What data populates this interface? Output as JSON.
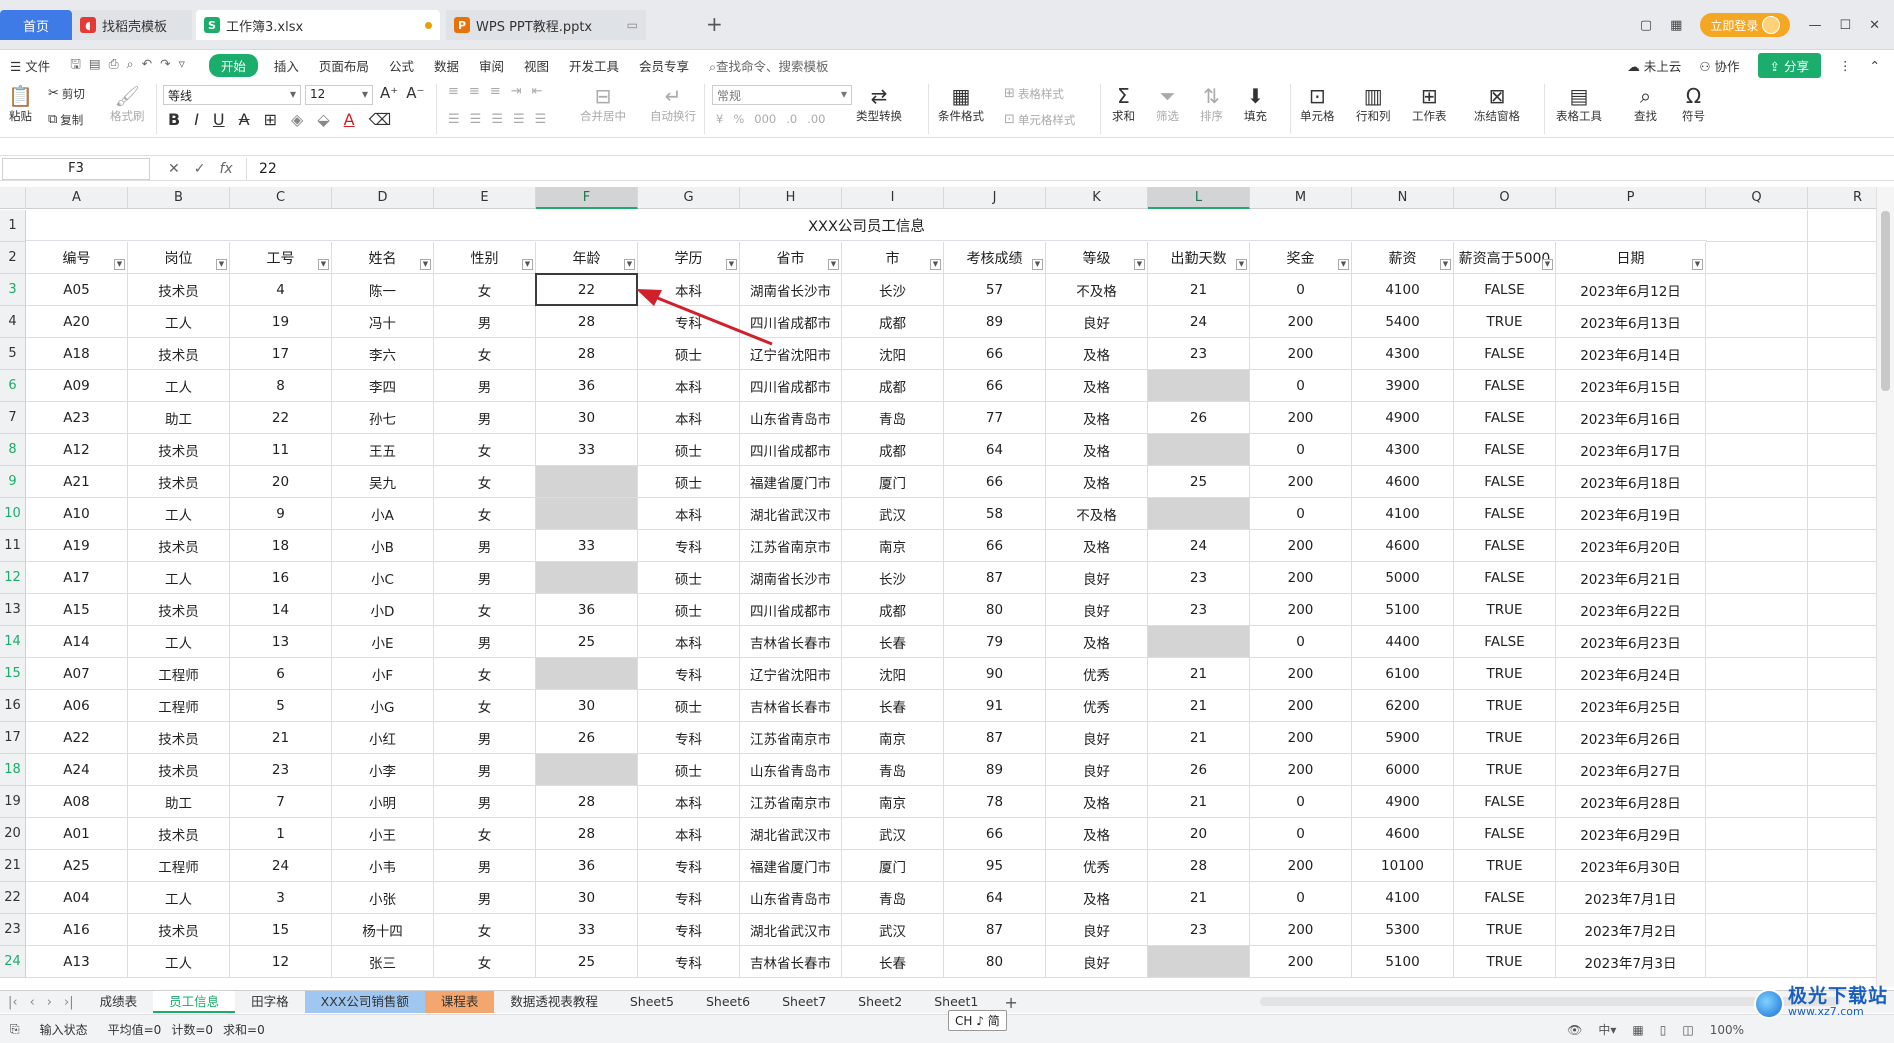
{
  "tabs": {
    "home": "首页",
    "t2": "找稻壳模板",
    "t3": "工作簿3.xlsx",
    "t4": "WPS PPT教程.pptx",
    "new": "+",
    "login": "立即登录"
  },
  "menu": {
    "file": "文件",
    "items": [
      "开始",
      "插入",
      "页面布局",
      "公式",
      "数据",
      "审阅",
      "视图",
      "开发工具",
      "会员专享"
    ],
    "search": "查找命令、搜索模板",
    "cloud": "未上云",
    "collab": "协作",
    "share": "分享"
  },
  "ribbon": {
    "paste": "粘贴",
    "cut": "剪切",
    "copy": "复制",
    "format_painter": "格式刷",
    "font": "等线",
    "size": "12",
    "merge": "合并居中",
    "wrap": "自动换行",
    "numfmt": "常规",
    "convert": "类型转换",
    "cond": "条件格式",
    "table_style": "表格样式",
    "cell_style": "单元格样式",
    "sum": "求和",
    "filter": "筛选",
    "sort": "排序",
    "fill": "填充",
    "cells": "单元格",
    "rowcol": "行和列",
    "sheet": "工作表",
    "freeze": "冻结窗格",
    "tools": "表格工具",
    "find": "查找",
    "symbol": "符号"
  },
  "formula": {
    "cell": "F3",
    "value": "22"
  },
  "columns": [
    "A",
    "B",
    "C",
    "D",
    "E",
    "F",
    "G",
    "H",
    "I",
    "J",
    "K",
    "L",
    "M",
    "N",
    "O",
    "P",
    "Q",
    "R"
  ],
  "title": "XXX公司员工信息",
  "headers": [
    "编号",
    "岗位",
    "工号",
    "姓名",
    "性别",
    "年龄",
    "学历",
    "省市",
    "市",
    "考核成绩",
    "等级",
    "出勤天数",
    "奖金",
    "薪资",
    "薪资高于5000",
    "日期"
  ],
  "rows": [
    [
      "3",
      [
        "A05",
        "技术员",
        "4",
        "陈一",
        "女",
        "22",
        "本科",
        "湖南省长沙市",
        "长沙",
        "57",
        "不及格",
        "21",
        "0",
        "4100",
        "FALSE",
        "2023年6月12日"
      ]
    ],
    [
      "4",
      [
        "A20",
        "工人",
        "19",
        "冯十",
        "男",
        "28",
        "专科",
        "四川省成都市",
        "成都",
        "89",
        "良好",
        "24",
        "200",
        "5400",
        "TRUE",
        "2023年6月13日"
      ]
    ],
    [
      "5",
      [
        "A18",
        "技术员",
        "17",
        "李六",
        "女",
        "28",
        "硕士",
        "辽宁省沈阳市",
        "沈阳",
        "66",
        "及格",
        "23",
        "200",
        "4300",
        "FALSE",
        "2023年6月14日"
      ]
    ],
    [
      "6",
      [
        "A09",
        "工人",
        "8",
        "李四",
        "男",
        "36",
        "本科",
        "四川省成都市",
        "成都",
        "66",
        "及格",
        "",
        "0",
        "3900",
        "FALSE",
        "2023年6月15日"
      ]
    ],
    [
      "7",
      [
        "A23",
        "助工",
        "22",
        "孙七",
        "男",
        "30",
        "本科",
        "山东省青岛市",
        "青岛",
        "77",
        "及格",
        "26",
        "200",
        "4900",
        "FALSE",
        "2023年6月16日"
      ]
    ],
    [
      "8",
      [
        "A12",
        "技术员",
        "11",
        "王五",
        "女",
        "33",
        "硕士",
        "四川省成都市",
        "成都",
        "64",
        "及格",
        "",
        "0",
        "4300",
        "FALSE",
        "2023年6月17日"
      ]
    ],
    [
      "9",
      [
        "A21",
        "技术员",
        "20",
        "吴九",
        "女",
        "",
        "硕士",
        "福建省厦门市",
        "厦门",
        "66",
        "及格",
        "25",
        "200",
        "4600",
        "FALSE",
        "2023年6月18日"
      ]
    ],
    [
      "10",
      [
        "A10",
        "工人",
        "9",
        "小A",
        "女",
        "",
        "本科",
        "湖北省武汉市",
        "武汉",
        "58",
        "不及格",
        "",
        "0",
        "4100",
        "FALSE",
        "2023年6月19日"
      ]
    ],
    [
      "11",
      [
        "A19",
        "技术员",
        "18",
        "小B",
        "男",
        "33",
        "专科",
        "江苏省南京市",
        "南京",
        "66",
        "及格",
        "24",
        "200",
        "4600",
        "FALSE",
        "2023年6月20日"
      ]
    ],
    [
      "12",
      [
        "A17",
        "工人",
        "16",
        "小C",
        "男",
        "",
        "硕士",
        "湖南省长沙市",
        "长沙",
        "87",
        "良好",
        "23",
        "200",
        "5000",
        "FALSE",
        "2023年6月21日"
      ]
    ],
    [
      "13",
      [
        "A15",
        "技术员",
        "14",
        "小D",
        "女",
        "36",
        "硕士",
        "四川省成都市",
        "成都",
        "80",
        "良好",
        "23",
        "200",
        "5100",
        "TRUE",
        "2023年6月22日"
      ]
    ],
    [
      "14",
      [
        "A14",
        "工人",
        "13",
        "小E",
        "男",
        "25",
        "本科",
        "吉林省长春市",
        "长春",
        "79",
        "及格",
        "",
        "0",
        "4400",
        "FALSE",
        "2023年6月23日"
      ]
    ],
    [
      "15",
      [
        "A07",
        "工程师",
        "6",
        "小F",
        "女",
        "",
        "专科",
        "辽宁省沈阳市",
        "沈阳",
        "90",
        "优秀",
        "21",
        "200",
        "6100",
        "TRUE",
        "2023年6月24日"
      ]
    ],
    [
      "16",
      [
        "A06",
        "工程师",
        "5",
        "小G",
        "女",
        "30",
        "硕士",
        "吉林省长春市",
        "长春",
        "91",
        "优秀",
        "21",
        "200",
        "6200",
        "TRUE",
        "2023年6月25日"
      ]
    ],
    [
      "17",
      [
        "A22",
        "技术员",
        "21",
        "小红",
        "男",
        "26",
        "专科",
        "江苏省南京市",
        "南京",
        "87",
        "良好",
        "21",
        "200",
        "5900",
        "TRUE",
        "2023年6月26日"
      ]
    ],
    [
      "18",
      [
        "A24",
        "技术员",
        "23",
        "小李",
        "男",
        "",
        "硕士",
        "山东省青岛市",
        "青岛",
        "89",
        "良好",
        "26",
        "200",
        "6000",
        "TRUE",
        "2023年6月27日"
      ]
    ],
    [
      "19",
      [
        "A08",
        "助工",
        "7",
        "小明",
        "男",
        "28",
        "本科",
        "江苏省南京市",
        "南京",
        "78",
        "及格",
        "21",
        "0",
        "4900",
        "FALSE",
        "2023年6月28日"
      ]
    ],
    [
      "20",
      [
        "A01",
        "技术员",
        "1",
        "小王",
        "女",
        "28",
        "本科",
        "湖北省武汉市",
        "武汉",
        "66",
        "及格",
        "20",
        "0",
        "4600",
        "FALSE",
        "2023年6月29日"
      ]
    ],
    [
      "21",
      [
        "A25",
        "工程师",
        "24",
        "小韦",
        "男",
        "36",
        "专科",
        "福建省厦门市",
        "厦门",
        "95",
        "优秀",
        "28",
        "200",
        "10100",
        "TRUE",
        "2023年6月30日"
      ]
    ],
    [
      "22",
      [
        "A04",
        "工人",
        "3",
        "小张",
        "男",
        "30",
        "专科",
        "山东省青岛市",
        "青岛",
        "64",
        "及格",
        "21",
        "0",
        "4100",
        "FALSE",
        "2023年7月1日"
      ]
    ],
    [
      "23",
      [
        "A16",
        "技术员",
        "15",
        "杨十四",
        "女",
        "33",
        "专科",
        "湖北省武汉市",
        "武汉",
        "87",
        "良好",
        "23",
        "200",
        "5300",
        "TRUE",
        "2023年7月2日"
      ]
    ],
    [
      "24",
      [
        "A13",
        "工人",
        "12",
        "张三",
        "女",
        "25",
        "专科",
        "吉林省长春市",
        "长春",
        "80",
        "良好",
        "",
        "200",
        "5100",
        "TRUE",
        "2023年7月3日"
      ]
    ]
  ],
  "greyCells": {
    "F": [
      "9",
      "10",
      "12",
      "15",
      "18"
    ],
    "L": [
      "6",
      "8",
      "10",
      "14",
      "24"
    ]
  },
  "greenRows": [
    "3",
    "6",
    "8",
    "9",
    "10",
    "12",
    "14",
    "15",
    "18",
    "24"
  ],
  "sheets": [
    "成绩表",
    "员工信息",
    "田字格",
    "XXX公司销售额",
    "课程表",
    "数据透视表教程",
    "Sheet5",
    "Sheet6",
    "Sheet7",
    "Sheet2",
    "Sheet1"
  ],
  "status": {
    "mode": "输入状态",
    "avg": "平均值=0",
    "count": "计数=0",
    "sum": "求和=0",
    "ime": "CH ♪ 简",
    "zoom": "100%"
  },
  "watermark": {
    "main": "极光下载站",
    "sub": "www.xz7.com"
  },
  "colors": {
    "accent": "#1aad6b",
    "home_tab": "#3f7be6",
    "grey_cell": "#d4d4d4",
    "arrow": "#d0202a"
  }
}
